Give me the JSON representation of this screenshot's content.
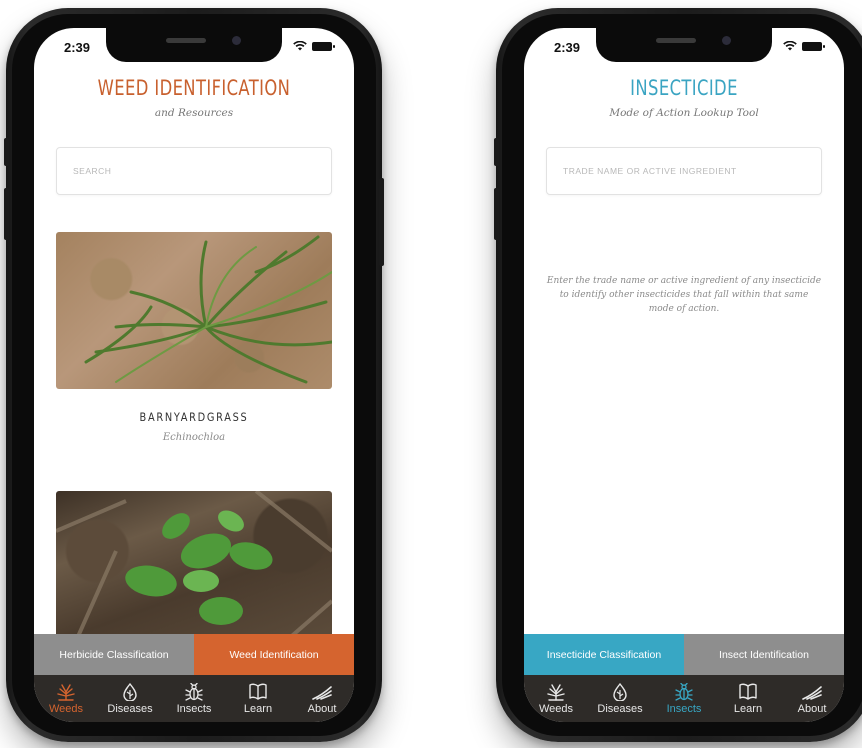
{
  "left_phone": {
    "status_time": "2:39",
    "title": "WEED IDENTIFICATION",
    "subtitle": "and Resources",
    "search_placeholder": "SEARCH",
    "card": {
      "name": "BARNYARDGRASS",
      "scientific": "Echinochloa"
    },
    "segment": {
      "left_label": "Herbicide Classification",
      "right_label": "Weed Identification",
      "active": "right"
    },
    "tabs": [
      {
        "label": "Weeds",
        "icon": "weed-icon"
      },
      {
        "label": "Diseases",
        "icon": "leaf-drop-icon"
      },
      {
        "label": "Insects",
        "icon": "bug-icon"
      },
      {
        "label": "Learn",
        "icon": "book-icon"
      },
      {
        "label": "About",
        "icon": "field-lines-icon"
      }
    ],
    "active_tab": "Weeds"
  },
  "right_phone": {
    "status_time": "2:39",
    "title": "INSECTICIDE",
    "subtitle": "Mode of Action Lookup Tool",
    "search_placeholder": "TRADE NAME OR ACTIVE INGREDIENT",
    "hint": "Enter the trade name or active ingredient of any insecticide to identify other insecticides that fall within that same mode of action.",
    "segment": {
      "left_label": "Insecticide Classification",
      "right_label": "Insect Identification",
      "active": "left"
    },
    "tabs": [
      {
        "label": "Weeds",
        "icon": "weed-icon"
      },
      {
        "label": "Diseases",
        "icon": "leaf-drop-icon"
      },
      {
        "label": "Insects",
        "icon": "bug-icon"
      },
      {
        "label": "Learn",
        "icon": "book-icon"
      },
      {
        "label": "About",
        "icon": "field-lines-icon"
      }
    ],
    "active_tab": "Insects"
  },
  "colors": {
    "weed_accent": "#d5642f",
    "insect_accent": "#38a7c4",
    "tabbar": "#2e2b28",
    "segment_inactive": "#8e8e8e"
  }
}
